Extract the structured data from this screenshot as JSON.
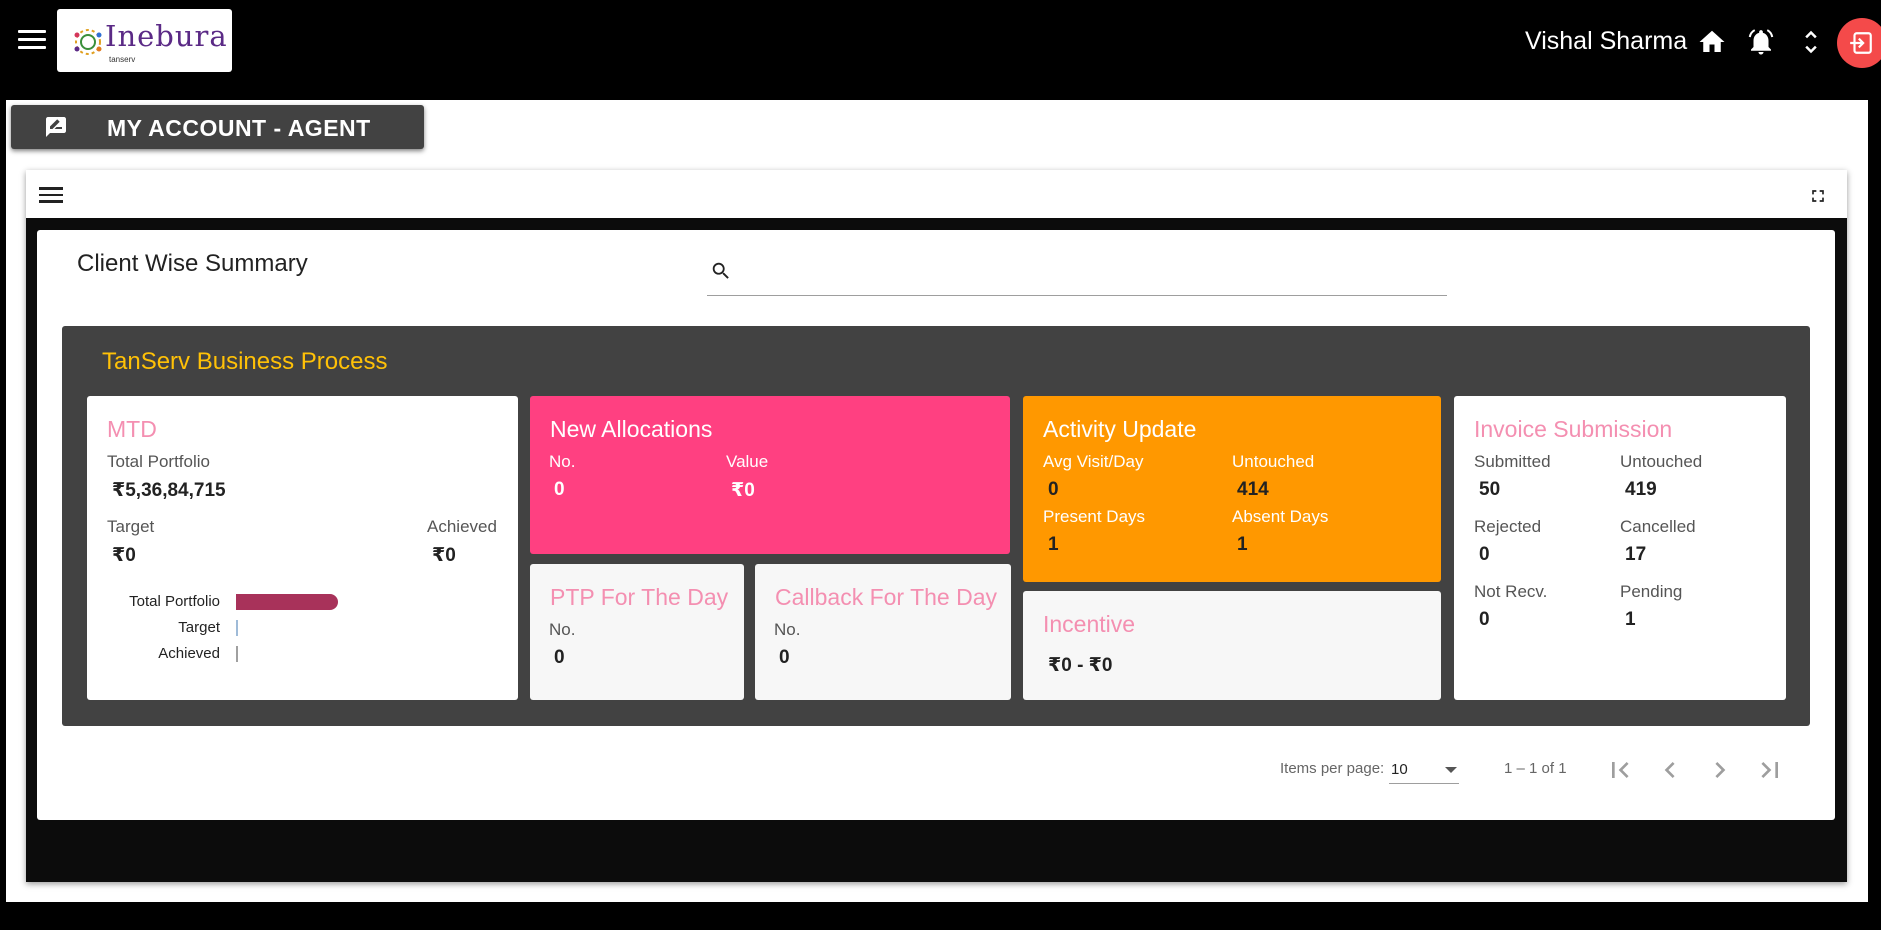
{
  "header": {
    "logo_text": "Inebura",
    "logo_sub": "tanserv",
    "user_name": "Vishal Sharma"
  },
  "page": {
    "title": "MY ACCOUNT - AGENT"
  },
  "summary": {
    "title": "Client Wise Summary",
    "search_placeholder": ""
  },
  "business": {
    "title": "TanServ Business Process",
    "mtd": {
      "title": "MTD",
      "total_portfolio_label": "Total Portfolio",
      "total_portfolio_value": "₹5,36,84,715",
      "target_label": "Target",
      "target_value": "₹0",
      "achieved_label": "Achieved",
      "achieved_value": "₹0",
      "bars": [
        {
          "label": "Total Portfolio",
          "value": 1
        },
        {
          "label": "Target",
          "value": 0
        },
        {
          "label": "Achieved",
          "value": 0
        }
      ]
    },
    "new_allocations": {
      "title": "New Allocations",
      "no_label": "No.",
      "no_value": "0",
      "value_label": "Value",
      "value_value": "₹0"
    },
    "ptp": {
      "title": "PTP For The Day",
      "no_label": "No.",
      "no_value": "0"
    },
    "callback": {
      "title": "Callback For The Day",
      "no_label": "No.",
      "no_value": "0"
    },
    "activity": {
      "title": "Activity Update",
      "avg_visit_label": "Avg Visit/Day",
      "avg_visit_value": "0",
      "untouched_label": "Untouched",
      "untouched_value": "414",
      "present_label": "Present Days",
      "present_value": "1",
      "absent_label": "Absent Days",
      "absent_value": "1"
    },
    "incentive": {
      "title": "Incentive",
      "value": "₹0 - ₹0"
    },
    "invoice": {
      "title": "Invoice Submission",
      "submitted_label": "Submitted",
      "submitted_value": "50",
      "untouched_label": "Untouched",
      "untouched_value": "419",
      "rejected_label": "Rejected",
      "rejected_value": "0",
      "cancelled_label": "Cancelled",
      "cancelled_value": "17",
      "notrecv_label": "Not Recv.",
      "notrecv_value": "0",
      "pending_label": "Pending",
      "pending_value": "1"
    }
  },
  "pager": {
    "items_label": "Items per page:",
    "items_value": "10",
    "range": "1 – 1 of 1"
  },
  "colors": {
    "accent_pink": "#ff4081",
    "accent_orange": "#ff9800",
    "title_yellow": "#ffc107",
    "bar_portfolio": "#a8325a"
  }
}
